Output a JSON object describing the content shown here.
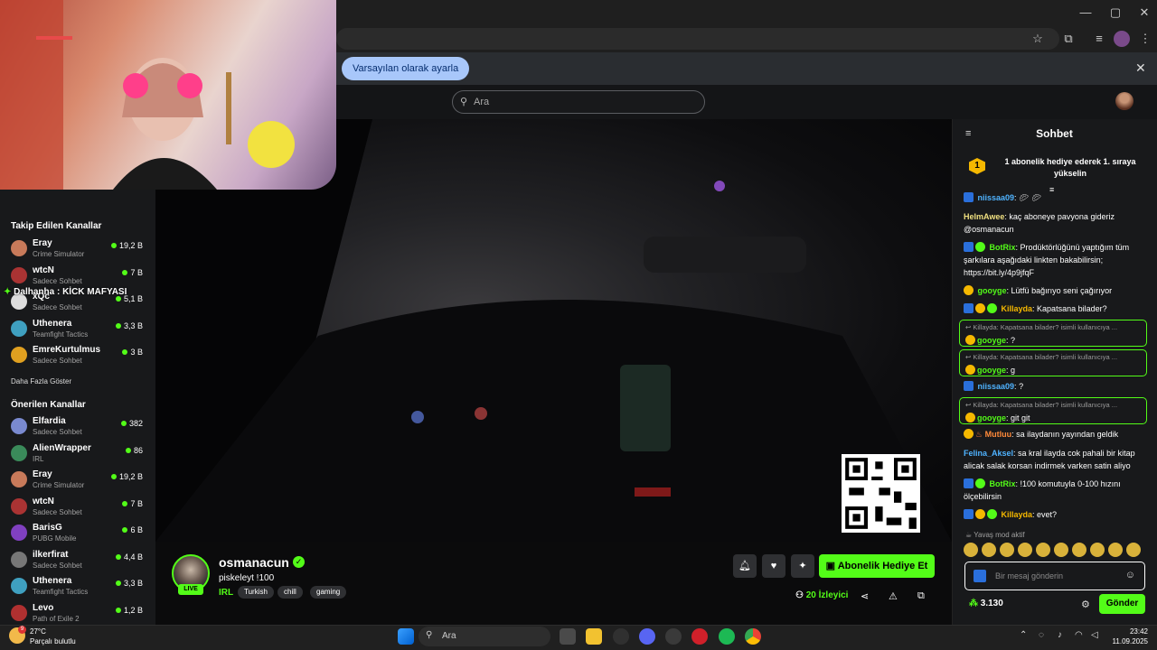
{
  "browser": {
    "info_button": "Varsayılan olarak ayarla"
  },
  "header": {
    "search_placeholder": "Ara"
  },
  "sidebar": {
    "followed_heading": "Takip Edilen Kanallar",
    "followed": [
      {
        "name": "Eray",
        "game": "Crime Simulator",
        "viewers": "19,2 B",
        "color": "#c87a5a"
      },
      {
        "name": "wtcN",
        "game": "Sadece Sohbet",
        "viewers": "7 B",
        "color": "#a33"
      },
      {
        "name": "xQc",
        "game": "Sadece Sohbet",
        "viewers": "5,1 B",
        "color": "#ddd"
      },
      {
        "name": "Uthenera",
        "game": "Teamfight Tactics",
        "viewers": "3,3 B",
        "color": "#3fa0c0"
      },
      {
        "name": "EmreKurtulmus",
        "game": "Sadece Sohbet",
        "viewers": "3 B",
        "color": "#e0a020"
      }
    ],
    "show_more": "Daha Fazla Göster",
    "recommended_heading": "Önerilen Kanallar",
    "recommended": [
      {
        "name": "Elfardia",
        "game": "Sadece Sohbet",
        "viewers": "382",
        "color": "#7a8ad0"
      },
      {
        "name": "AlienWrapper",
        "game": "IRL",
        "viewers": "86",
        "color": "#3a8a5a"
      },
      {
        "name": "Eray",
        "game": "Crime Simulator",
        "viewers": "19,2 B",
        "color": "#c87a5a"
      },
      {
        "name": "wtcN",
        "game": "Sadece Sohbet",
        "viewers": "7 B",
        "color": "#a33"
      },
      {
        "name": "BarisG",
        "game": "PUBG Mobile",
        "viewers": "6 B",
        "color": "#8040c0"
      },
      {
        "name": "ilkerfirat",
        "game": "Sadece Sohbet",
        "viewers": "4,4 B",
        "color": "#777"
      },
      {
        "name": "Uthenera",
        "game": "Teamfight Tactics",
        "viewers": "3,3 B",
        "color": "#3fa0c0"
      },
      {
        "name": "Levo",
        "game": "Path of Exile 2",
        "viewers": "1,2 B",
        "color": "#b03030"
      }
    ],
    "overlay_text": "Dalhanha : KİCK MAFYASI"
  },
  "stream": {
    "streamer": "osmanacun",
    "live_label": "LIVE",
    "title": "piskeleyt !100",
    "category": "IRL",
    "tags": [
      "Turkish",
      "chill",
      "gaming"
    ],
    "gift_button": "Abonelik Hediye Et",
    "viewer_count": "20",
    "viewer_label": "İzleyici"
  },
  "chat": {
    "title": "Sohbet",
    "pinned_rank": "1",
    "pinned_text": "1 abonelik hediye ederek 1. sıraya yükselin",
    "messages": [
      {
        "user": "niissaa09",
        "text": "",
        "color": "#4fb3ff"
      },
      {
        "user": "HelmAwee",
        "text": "kaç aboneye pavyona gideriz @osmanacun",
        "color": "#f0e080"
      },
      {
        "user": "BotRix",
        "text": "Prodüktörlüğünü yaptığım tüm şarkılara aşağıdaki linkten bakabilirsin; https://bit.ly/4p9jfqF",
        "color": "#53fc18"
      },
      {
        "user": "gooyge",
        "text": "Lütfü bağırıyo seni çağırıyor",
        "color": "#53fc18"
      },
      {
        "user": "Killayda",
        "text": "Kapatsana bilader?",
        "color": "#f5b800"
      }
    ],
    "replies": [
      {
        "context": "Killayda: Kapatsana bilader? isimli kullanıcıya ...",
        "user": "gooyge",
        "text": "?"
      },
      {
        "context": "Killayda: Kapatsana bilader? isimli kullanıcıya ...",
        "user": "gooyge",
        "text": "g"
      }
    ],
    "messages2": [
      {
        "user": "niissaa09",
        "text": "?"
      }
    ],
    "reply3": {
      "context": "Killayda: Kapatsana bilader? isimli kullanıcıya ...",
      "user": "gooyge",
      "text": "git git"
    },
    "messages3": [
      {
        "user": "Mutluu",
        "text": "sa ilaydanın yayından geldik",
        "color": "#ff8a3a"
      },
      {
        "user": "Felina_Aksel",
        "text": "sa kral ilayda cok pahali bir kitap alicak salak korsan indirmek varken satin aliyo",
        "color": "#4fb3ff"
      },
      {
        "user": "BotRix",
        "text": "!100 komutuyla 0-100 hızını ölçebilirsin",
        "color": "#53fc18"
      },
      {
        "user": "Killayda",
        "text": "evet?",
        "color": "#f5b800"
      }
    ],
    "slow_mode": "Yavaş mod aktif",
    "input_placeholder": "Bir mesaj gönderin",
    "points": "3.130",
    "send_button": "Gönder"
  },
  "taskbar": {
    "temperature": "27°C",
    "weather": "Parçalı bulutlu",
    "search": "Ara",
    "time": "23:42",
    "date": "11.09.2025",
    "notification_count": "9"
  }
}
